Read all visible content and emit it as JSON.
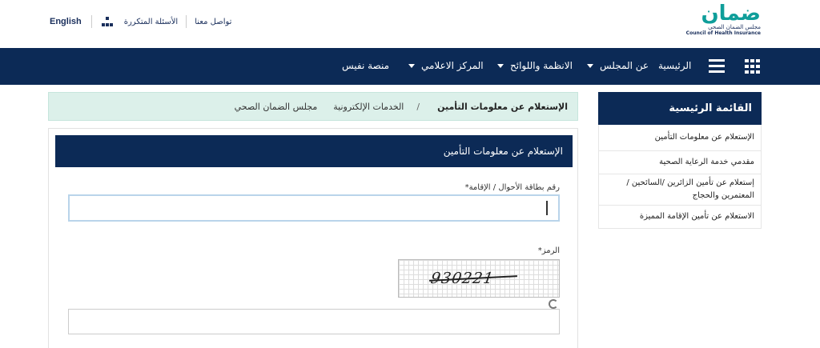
{
  "logo": {
    "wordmark": "ضمان",
    "subtitle_ar": "مجلس الضمان الصحي",
    "subtitle_en": "Council of Health Insurance"
  },
  "toplinks": {
    "english": "English",
    "faq": "الأسئلة المتكررة",
    "contact": "تواصل معنا",
    "sitemap_icon": "sitemap-icon"
  },
  "nav": {
    "home": "الرئيسية",
    "about": "عن المجلس",
    "regulations": "الانظمة واللوائح",
    "media": "المركز الاعلامي",
    "nafis": "منصة نفيس",
    "menu_icon": "hamburger-icon",
    "grid_icon": "grid-icon"
  },
  "breadcrumb": {
    "level1": "مجلس الضمان الصحي",
    "level2": "الخدمات الإلكترونية",
    "separator": "/",
    "current": "الإستعلام عن معلومات التأمين"
  },
  "form": {
    "title": "الإستعلام عن معلومات التأمين",
    "id_label": "رقم بطاقة الأحوال / الإقامة*",
    "id_value": "",
    "code_label": "الرمز*",
    "captcha_text": "930221",
    "code_value": "",
    "refresh_icon": "refresh-icon"
  },
  "sidebar": {
    "title": "القائمة الرئيسية",
    "items": [
      {
        "label": "الإستعلام عن معلومات التأمين"
      },
      {
        "label": "مقدمي خدمة الرعاية الصحية"
      },
      {
        "label": "إستعلام عن تأمين الزائرين /السائحين / المعتمرين والحجاج"
      },
      {
        "label": "الاستعلام عن تأمين الإقامة المميزة"
      }
    ]
  },
  "colors": {
    "navy": "#0c2a56",
    "breadcrumb_bg": "#dcf0ea",
    "brand_teal": "#0f9e9a"
  }
}
